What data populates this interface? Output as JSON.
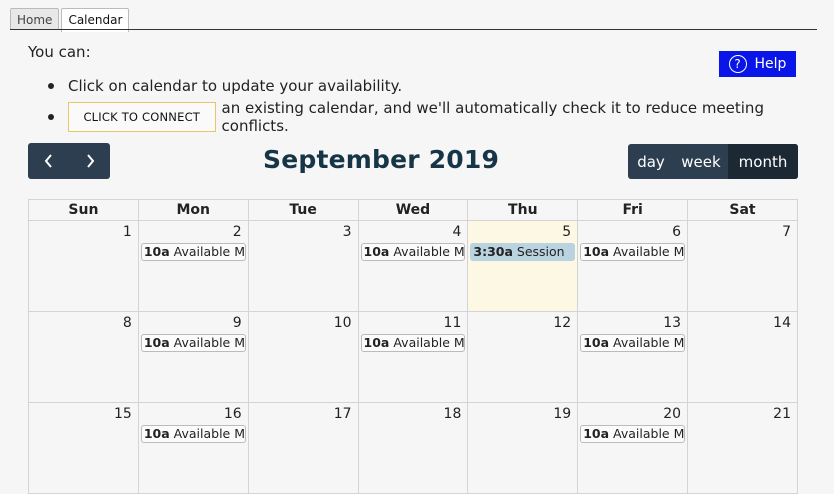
{
  "tabs": [
    {
      "label": "Home"
    },
    {
      "label": "Calendar"
    }
  ],
  "intro_text": "You can:",
  "help_label": "Help",
  "bullets": {
    "first": "Click on calendar to update your availability.",
    "connect_button": "CLICK TO CONNECT",
    "second_suffix": "an existing calendar, and we'll automatically check it to reduce meeting conflicts."
  },
  "nav": {
    "prev": "‹",
    "next": "›"
  },
  "month_title": "September 2019",
  "views": {
    "day": "day",
    "week": "week",
    "month": "month"
  },
  "weekdays": [
    "Sun",
    "Mon",
    "Tue",
    "Wed",
    "Thu",
    "Fri",
    "Sat"
  ],
  "weeks": [
    [
      {
        "day": "1",
        "events": []
      },
      {
        "day": "2",
        "events": [
          {
            "time": "10a",
            "title": "Available MWF"
          }
        ]
      },
      {
        "day": "3",
        "events": []
      },
      {
        "day": "4",
        "events": [
          {
            "time": "10a",
            "title": "Available MWF"
          }
        ]
      },
      {
        "day": "5",
        "today": true,
        "events": [
          {
            "time": "3:30a",
            "title": "Session",
            "kind": "session"
          }
        ]
      },
      {
        "day": "6",
        "events": [
          {
            "time": "10a",
            "title": "Available MWF"
          }
        ]
      },
      {
        "day": "7",
        "events": []
      }
    ],
    [
      {
        "day": "8",
        "events": []
      },
      {
        "day": "9",
        "events": [
          {
            "time": "10a",
            "title": "Available MWF"
          }
        ]
      },
      {
        "day": "10",
        "events": []
      },
      {
        "day": "11",
        "events": [
          {
            "time": "10a",
            "title": "Available MWF"
          }
        ]
      },
      {
        "day": "12",
        "events": []
      },
      {
        "day": "13",
        "events": [
          {
            "time": "10a",
            "title": "Available MWF"
          }
        ]
      },
      {
        "day": "14",
        "events": []
      }
    ],
    [
      {
        "day": "15",
        "events": []
      },
      {
        "day": "16",
        "events": [
          {
            "time": "10a",
            "title": "Available MWF"
          }
        ]
      },
      {
        "day": "17",
        "events": []
      },
      {
        "day": "18",
        "events": []
      },
      {
        "day": "19",
        "events": []
      },
      {
        "day": "20",
        "events": [
          {
            "time": "10a",
            "title": "Available MWF"
          }
        ]
      },
      {
        "day": "21",
        "events": []
      }
    ]
  ]
}
